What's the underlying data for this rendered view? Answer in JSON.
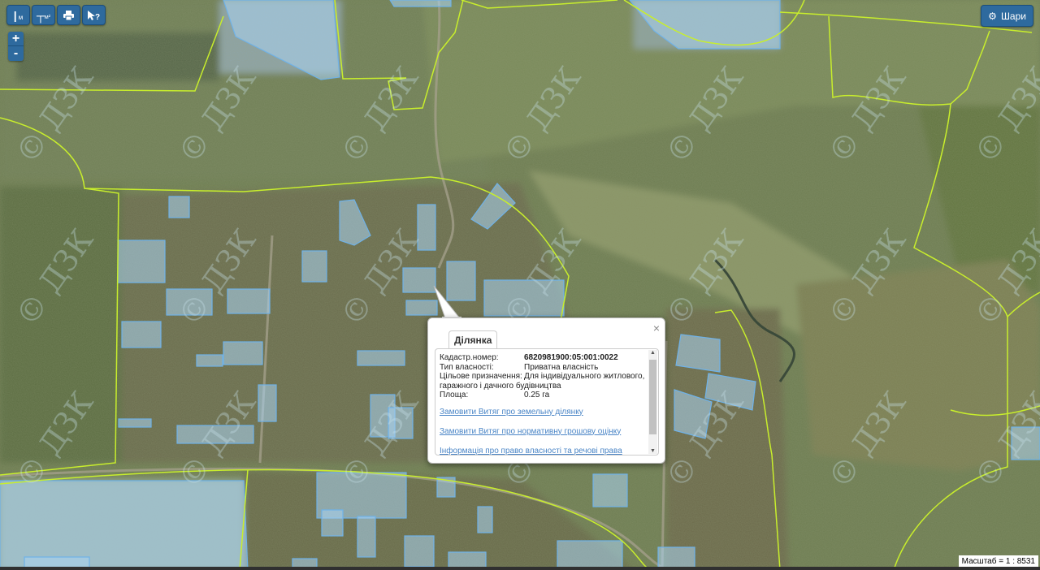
{
  "toolbar": {
    "buttons": [
      {
        "id": "measure-line",
        "label": "м"
      },
      {
        "id": "measure-area",
        "label": "м²"
      },
      {
        "id": "print",
        "label": "print"
      },
      {
        "id": "identify",
        "label": "?"
      }
    ]
  },
  "zoom": {
    "in": "+",
    "out": "-"
  },
  "layers_button": {
    "label": "Шари",
    "icon": "gear-icon"
  },
  "watermark_text": "© ДЗК",
  "popup": {
    "tab": "Ділянка",
    "close": "×",
    "fields": [
      {
        "label": "Кадастр.номер:",
        "value": "6820981900:05:001:0022",
        "bold": true
      },
      {
        "label": "Тип власності:",
        "value": "Приватна власність",
        "bold": false
      },
      {
        "label": "Цільове призначення:",
        "value": "Для індивідуального житлового, гаражного і дачного будівництва",
        "bold": false
      },
      {
        "label": "Площа:",
        "value": "0.25 га",
        "bold": false
      }
    ],
    "links": [
      "Замовити Витяг про земельну ділянку",
      "Замовити Витяг про нормативну грошову оцінку",
      "Інформація про право власності та речові права"
    ]
  },
  "scale": {
    "text": "Масштаб = 1 : 8531"
  },
  "colors": {
    "boundary": "#c8ee2c",
    "parcel_fill": "#a9d4f2",
    "parcel_stroke": "#6fb2e8",
    "button_bg": "#2e6a9e",
    "link": "#4a85c6"
  }
}
